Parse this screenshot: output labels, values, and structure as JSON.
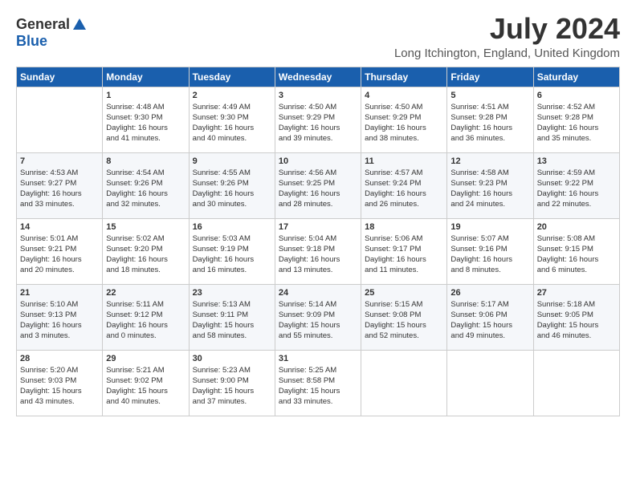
{
  "header": {
    "logo_general": "General",
    "logo_blue": "Blue",
    "month_year": "July 2024",
    "location": "Long Itchington, England, United Kingdom"
  },
  "columns": [
    "Sunday",
    "Monday",
    "Tuesday",
    "Wednesday",
    "Thursday",
    "Friday",
    "Saturday"
  ],
  "weeks": [
    [
      {
        "day": "",
        "info": ""
      },
      {
        "day": "1",
        "info": "Sunrise: 4:48 AM\nSunset: 9:30 PM\nDaylight: 16 hours\nand 41 minutes."
      },
      {
        "day": "2",
        "info": "Sunrise: 4:49 AM\nSunset: 9:30 PM\nDaylight: 16 hours\nand 40 minutes."
      },
      {
        "day": "3",
        "info": "Sunrise: 4:50 AM\nSunset: 9:29 PM\nDaylight: 16 hours\nand 39 minutes."
      },
      {
        "day": "4",
        "info": "Sunrise: 4:50 AM\nSunset: 9:29 PM\nDaylight: 16 hours\nand 38 minutes."
      },
      {
        "day": "5",
        "info": "Sunrise: 4:51 AM\nSunset: 9:28 PM\nDaylight: 16 hours\nand 36 minutes."
      },
      {
        "day": "6",
        "info": "Sunrise: 4:52 AM\nSunset: 9:28 PM\nDaylight: 16 hours\nand 35 minutes."
      }
    ],
    [
      {
        "day": "7",
        "info": "Sunrise: 4:53 AM\nSunset: 9:27 PM\nDaylight: 16 hours\nand 33 minutes."
      },
      {
        "day": "8",
        "info": "Sunrise: 4:54 AM\nSunset: 9:26 PM\nDaylight: 16 hours\nand 32 minutes."
      },
      {
        "day": "9",
        "info": "Sunrise: 4:55 AM\nSunset: 9:26 PM\nDaylight: 16 hours\nand 30 minutes."
      },
      {
        "day": "10",
        "info": "Sunrise: 4:56 AM\nSunset: 9:25 PM\nDaylight: 16 hours\nand 28 minutes."
      },
      {
        "day": "11",
        "info": "Sunrise: 4:57 AM\nSunset: 9:24 PM\nDaylight: 16 hours\nand 26 minutes."
      },
      {
        "day": "12",
        "info": "Sunrise: 4:58 AM\nSunset: 9:23 PM\nDaylight: 16 hours\nand 24 minutes."
      },
      {
        "day": "13",
        "info": "Sunrise: 4:59 AM\nSunset: 9:22 PM\nDaylight: 16 hours\nand 22 minutes."
      }
    ],
    [
      {
        "day": "14",
        "info": "Sunrise: 5:01 AM\nSunset: 9:21 PM\nDaylight: 16 hours\nand 20 minutes."
      },
      {
        "day": "15",
        "info": "Sunrise: 5:02 AM\nSunset: 9:20 PM\nDaylight: 16 hours\nand 18 minutes."
      },
      {
        "day": "16",
        "info": "Sunrise: 5:03 AM\nSunset: 9:19 PM\nDaylight: 16 hours\nand 16 minutes."
      },
      {
        "day": "17",
        "info": "Sunrise: 5:04 AM\nSunset: 9:18 PM\nDaylight: 16 hours\nand 13 minutes."
      },
      {
        "day": "18",
        "info": "Sunrise: 5:06 AM\nSunset: 9:17 PM\nDaylight: 16 hours\nand 11 minutes."
      },
      {
        "day": "19",
        "info": "Sunrise: 5:07 AM\nSunset: 9:16 PM\nDaylight: 16 hours\nand 8 minutes."
      },
      {
        "day": "20",
        "info": "Sunrise: 5:08 AM\nSunset: 9:15 PM\nDaylight: 16 hours\nand 6 minutes."
      }
    ],
    [
      {
        "day": "21",
        "info": "Sunrise: 5:10 AM\nSunset: 9:13 PM\nDaylight: 16 hours\nand 3 minutes."
      },
      {
        "day": "22",
        "info": "Sunrise: 5:11 AM\nSunset: 9:12 PM\nDaylight: 16 hours\nand 0 minutes."
      },
      {
        "day": "23",
        "info": "Sunrise: 5:13 AM\nSunset: 9:11 PM\nDaylight: 15 hours\nand 58 minutes."
      },
      {
        "day": "24",
        "info": "Sunrise: 5:14 AM\nSunset: 9:09 PM\nDaylight: 15 hours\nand 55 minutes."
      },
      {
        "day": "25",
        "info": "Sunrise: 5:15 AM\nSunset: 9:08 PM\nDaylight: 15 hours\nand 52 minutes."
      },
      {
        "day": "26",
        "info": "Sunrise: 5:17 AM\nSunset: 9:06 PM\nDaylight: 15 hours\nand 49 minutes."
      },
      {
        "day": "27",
        "info": "Sunrise: 5:18 AM\nSunset: 9:05 PM\nDaylight: 15 hours\nand 46 minutes."
      }
    ],
    [
      {
        "day": "28",
        "info": "Sunrise: 5:20 AM\nSunset: 9:03 PM\nDaylight: 15 hours\nand 43 minutes."
      },
      {
        "day": "29",
        "info": "Sunrise: 5:21 AM\nSunset: 9:02 PM\nDaylight: 15 hours\nand 40 minutes."
      },
      {
        "day": "30",
        "info": "Sunrise: 5:23 AM\nSunset: 9:00 PM\nDaylight: 15 hours\nand 37 minutes."
      },
      {
        "day": "31",
        "info": "Sunrise: 5:25 AM\nSunset: 8:58 PM\nDaylight: 15 hours\nand 33 minutes."
      },
      {
        "day": "",
        "info": ""
      },
      {
        "day": "",
        "info": ""
      },
      {
        "day": "",
        "info": ""
      }
    ]
  ]
}
